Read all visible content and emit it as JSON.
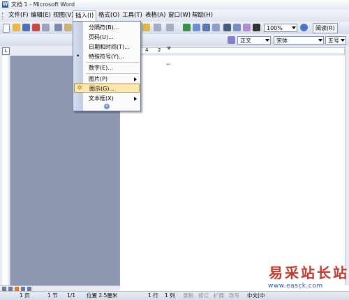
{
  "window": {
    "title": "文档 1 - Microsoft Word",
    "app_icon": "word-icon"
  },
  "menubar": {
    "items": [
      {
        "label": "文件(F)"
      },
      {
        "label": "编辑(E)"
      },
      {
        "label": "视图(V)"
      },
      {
        "label": "插入(I)"
      },
      {
        "label": "格式(O)"
      },
      {
        "label": "工具(T)"
      },
      {
        "label": "表格(A)"
      },
      {
        "label": "窗口(W)"
      },
      {
        "label": "帮助(H)"
      }
    ]
  },
  "insert_menu": {
    "items": [
      {
        "label": "分隔符(B)..."
      },
      {
        "label": "页码(U)..."
      },
      {
        "label": "日期和时间(T)..."
      },
      {
        "label": "特殊符号(Y)..."
      },
      {
        "label": "数字(E)..."
      },
      {
        "label": "图片(P)"
      },
      {
        "label": "图示(G)..."
      },
      {
        "label": "文本框(X)"
      }
    ],
    "highlighted": "图示(G)...",
    "expand_icon": "expand-chevrons-icon"
  },
  "toolbar": {
    "zoom": "100%",
    "read_button": "阅读(R)",
    "style": "正文",
    "font": "宋体",
    "font_size": "五号"
  },
  "ruler": {
    "corner_label": "L",
    "numbers": [
      "4",
      "2"
    ]
  },
  "status": {
    "page": "1 页",
    "section": "1 节",
    "page_of": "1/1",
    "position": "位置 2.5厘米",
    "line": "1 行",
    "column": "1 列",
    "rec": "录制",
    "trk": "修订",
    "ext": "扩展",
    "ovr": "改写",
    "lang": "中文(中"
  },
  "watermark": {
    "text": "易采站长站",
    "url": "www.easck.com"
  },
  "colors": {
    "menu_highlight": "#fde8b0",
    "watermark_red": "#c0392b",
    "watermark_blue": "#2a57b5"
  }
}
